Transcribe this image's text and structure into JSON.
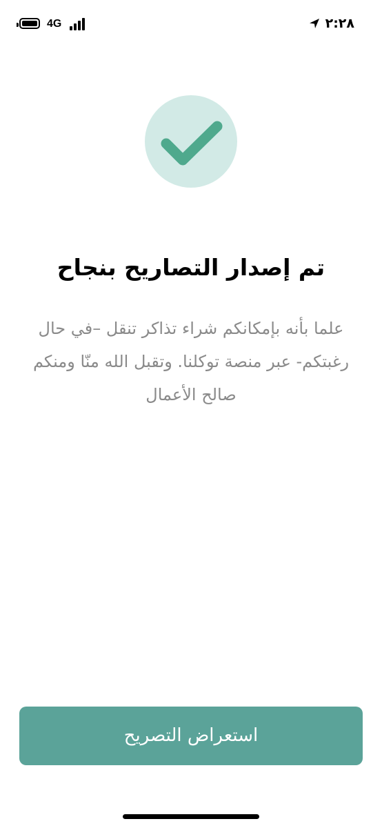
{
  "status_bar": {
    "network": "4G",
    "time": "٢:٢٨",
    "icons": [
      "battery-icon",
      "signal-icon",
      "location-arrow-icon"
    ]
  },
  "success": {
    "icon": "checkmark-icon",
    "title": "تم إصدار التصاريح بنجاح",
    "message": "علما بأنه بإمكانكم شراء تذاكر تنقل –في حال رغبتكم- عبر منصة توكلنا. وتقبل الله منّا ومنكم صالح الأعمال"
  },
  "actions": {
    "view_permit_label": "استعراض التصريح"
  },
  "colors": {
    "accent": "#5ba399",
    "check": "#4fa98d",
    "badge_bg": "#d2eae6",
    "message_text": "#8a8a8a"
  }
}
